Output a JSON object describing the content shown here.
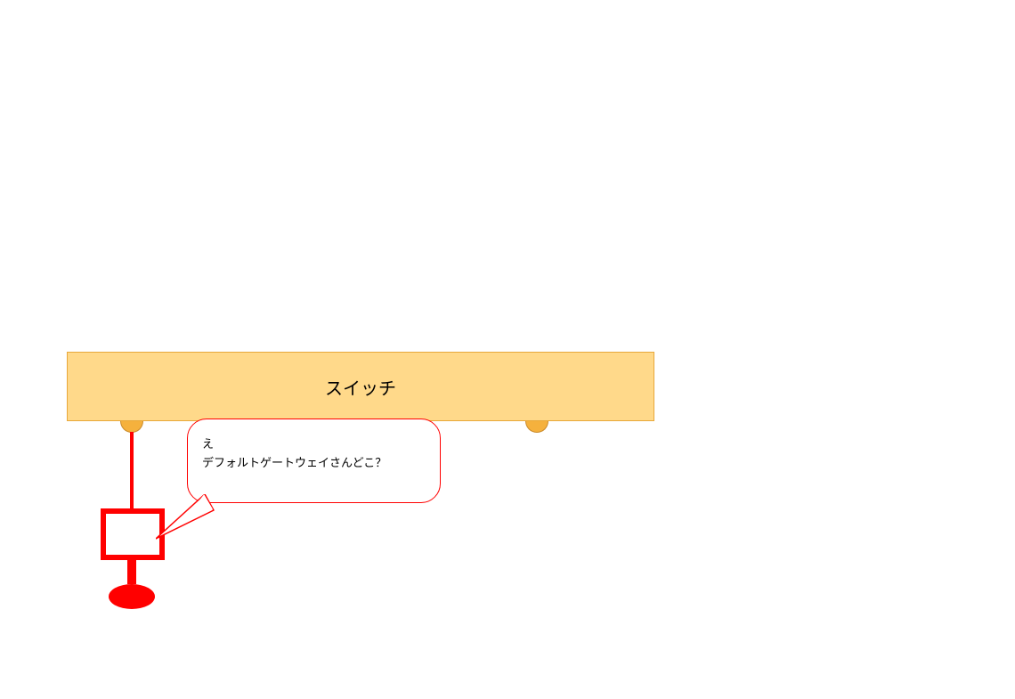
{
  "switch": {
    "label": "スイッチ"
  },
  "speech": {
    "line1": "え",
    "line2": "デフォルトゲートウェイさんどこ？"
  },
  "colors": {
    "switch_fill": "#ffd98a",
    "switch_border": "#e8a83a",
    "port_fill": "#f5b13d",
    "port_border": "#c98a2a",
    "red": "#ff0000"
  }
}
